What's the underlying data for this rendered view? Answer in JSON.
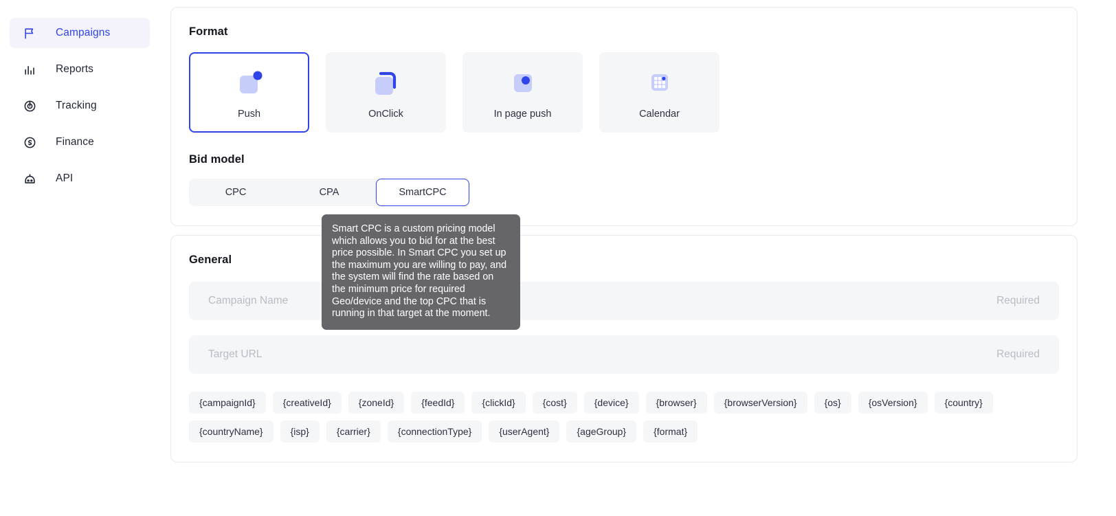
{
  "sidebar": {
    "items": [
      {
        "label": "Campaigns",
        "icon": "flag-icon",
        "active": true
      },
      {
        "label": "Reports",
        "icon": "bar-chart-icon",
        "active": false
      },
      {
        "label": "Tracking",
        "icon": "radar-icon",
        "active": false
      },
      {
        "label": "Finance",
        "icon": "coin-icon",
        "active": false
      },
      {
        "label": "API",
        "icon": "robot-icon",
        "active": false
      }
    ]
  },
  "format": {
    "title": "Format",
    "options": [
      {
        "label": "Push",
        "icon": "push-notification-icon",
        "selected": true
      },
      {
        "label": "OnClick",
        "icon": "onclick-window-icon",
        "selected": false
      },
      {
        "label": "In page push",
        "icon": "in-page-push-icon",
        "selected": false
      },
      {
        "label": "Calendar",
        "icon": "calendar-grid-icon",
        "selected": false
      }
    ]
  },
  "bid_model": {
    "title": "Bid model",
    "options": [
      {
        "label": "CPC",
        "selected": false
      },
      {
        "label": "CPA",
        "selected": false
      },
      {
        "label": "SmartCPC",
        "selected": true
      }
    ]
  },
  "tooltip": {
    "text": "Smart CPC is a custom pricing model which allows you to bid for at the best price possible. In Smart CPC you set up the maximum you are willing to pay, and the system will find the rate based on the minimum price for required Geo/device and the top CPC that is running in that target at the moment."
  },
  "general": {
    "title": "General",
    "fields": [
      {
        "placeholder": "Campaign Name",
        "value": "",
        "required_label": "Required"
      },
      {
        "placeholder": "Target URL",
        "value": "",
        "required_label": "Required"
      }
    ],
    "macros": [
      "{campaignId}",
      "{creativeId}",
      "{zoneId}",
      "{feedId}",
      "{clickId}",
      "{cost}",
      "{device}",
      "{browser}",
      "{browserVersion}",
      "{os}",
      "{osVersion}",
      "{country}",
      "{countryName}",
      "{isp}",
      "{carrier}",
      "{connectionType}",
      "{userAgent}",
      "{ageGroup}",
      "{format}"
    ]
  },
  "colors": {
    "accent": "#2f44e8",
    "accent_soft": "#c6cdfa",
    "surface": "#f5f6f8",
    "active_nav_bg": "#f4f2fb",
    "tooltip_bg": "#66666a",
    "muted_text": "#b9bcc4"
  }
}
